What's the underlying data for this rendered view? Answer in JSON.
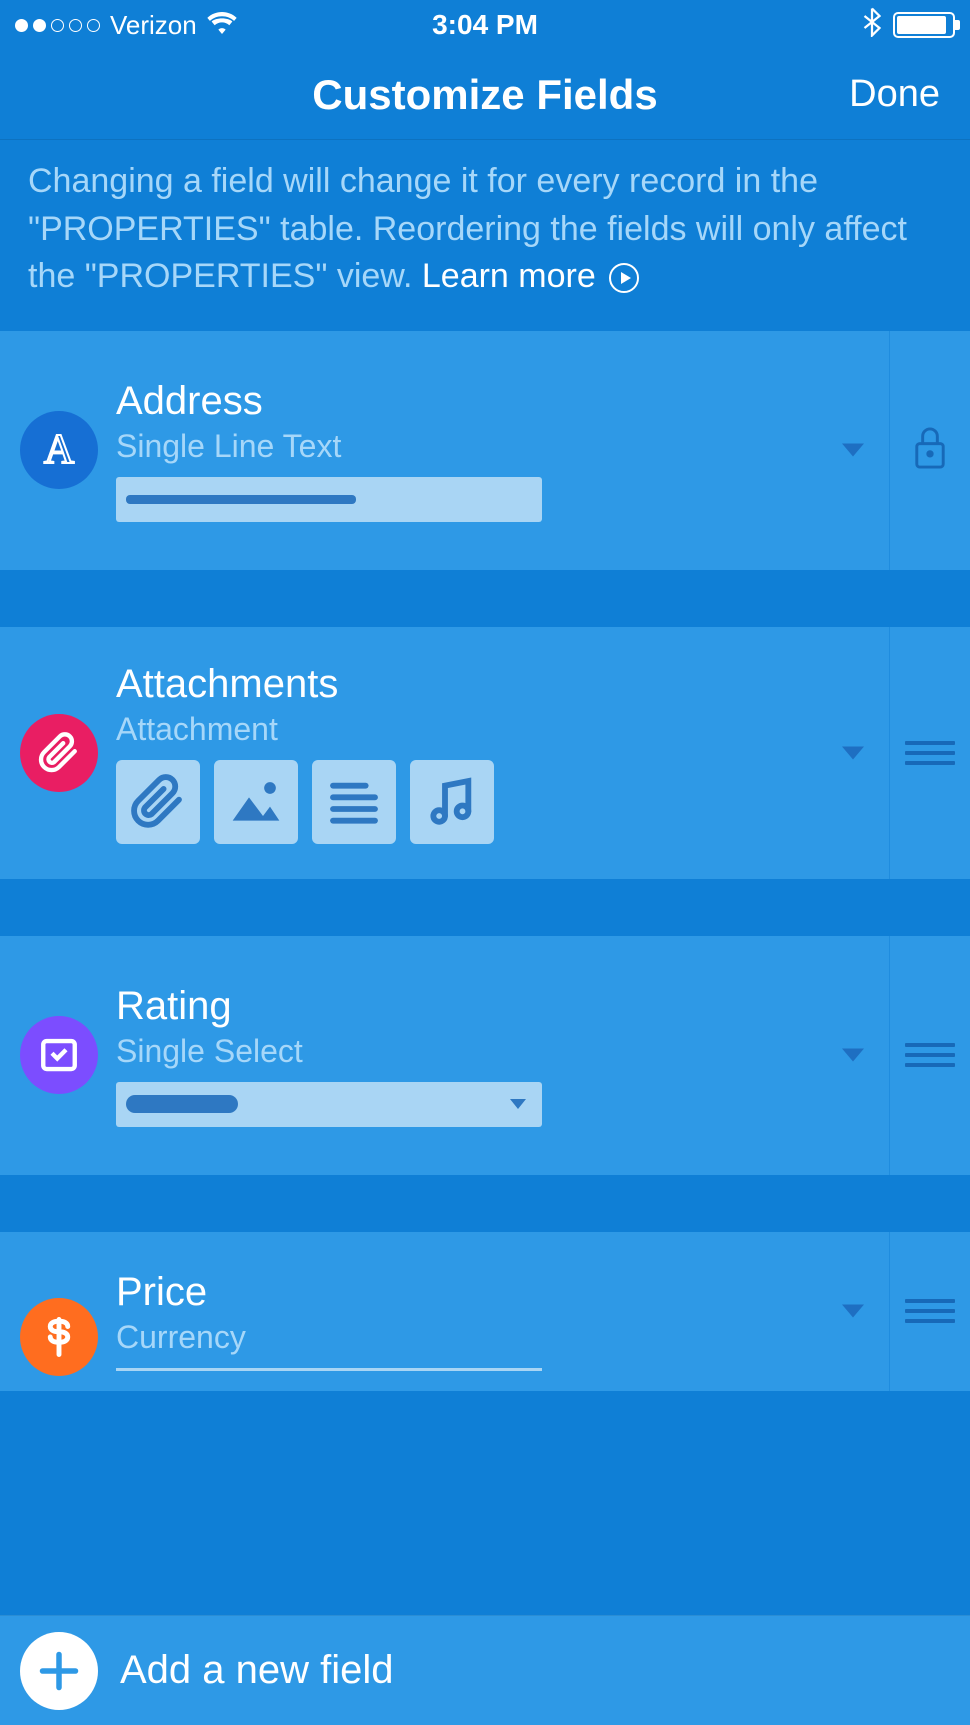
{
  "status_bar": {
    "carrier": "Verizon",
    "time": "3:04 PM"
  },
  "nav": {
    "title": "Customize Fields",
    "done": "Done"
  },
  "info": {
    "text_part1": "Changing a field will change it for every record in the \"PROPERTIES\" table. Reordering the fields will only affect the \"PROPERTIES\" view. ",
    "learn_more": "Learn more"
  },
  "fields": [
    {
      "name": "Address",
      "type": "Single Line Text",
      "icon": "text-a",
      "icon_color": "blue",
      "locked": true
    },
    {
      "name": "Attachments",
      "type": "Attachment",
      "icon": "paperclip",
      "icon_color": "pink",
      "locked": false
    },
    {
      "name": "Rating",
      "type": "Single Select",
      "icon": "select",
      "icon_color": "purple",
      "locked": false
    },
    {
      "name": "Price",
      "type": "Currency",
      "icon": "dollar",
      "icon_color": "orange",
      "locked": false
    }
  ],
  "add_field": {
    "label": "Add a new field"
  }
}
